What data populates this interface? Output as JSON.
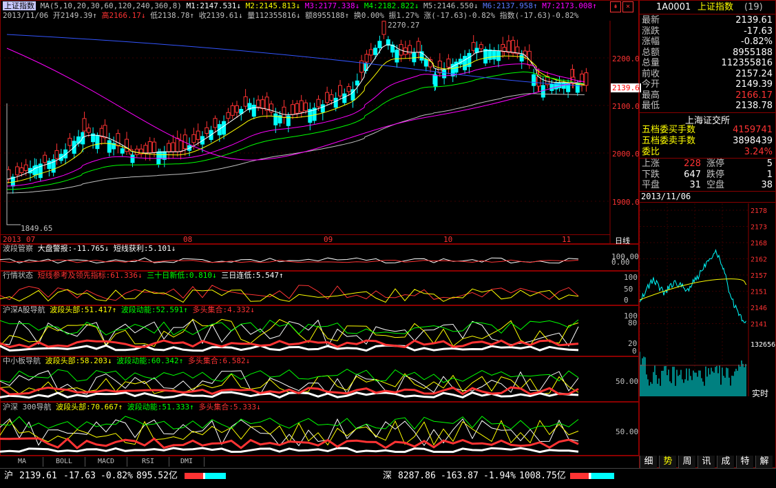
{
  "header": {
    "index_name": "上证指数",
    "ma_label": "MA(5,10,20,30,60,120,240,360,8)",
    "m1": "M1:2147.531↓",
    "m2": "M2:2145.813↓",
    "m3": "M3:2177.338↓",
    "m4": "M4:2182.822↓",
    "m5": "M5:2146.550↓",
    "m6": "M6:2137.958↑",
    "m7": "M7:2173.008↑",
    "date": "2013/11/06",
    "open": "开2149.39↑",
    "high": "高2166.17↓",
    "low": "低2138.78↑",
    "close": "收2139.61↓",
    "vol": "量112355816↓",
    "amount": "额8955188↑",
    "turnover": "换0.00%",
    "amplitude": "振1.27%",
    "change": "涨(-17.63)-0.82%",
    "index_change": "指数(-17.63)-0.82%"
  },
  "main_chart": {
    "peak_label": "2270.27",
    "low_label": "1849.65",
    "price_tag": "2139.6",
    "y_ticks": [
      "2200.0",
      "2100.0",
      "2000.0",
      "1900.0"
    ],
    "x_ticks": [
      "2013",
      "07",
      "08",
      "09",
      "10",
      "11"
    ],
    "period": "日线"
  },
  "indicators": [
    {
      "name": "波段管察",
      "items": [
        "大盘警报:-11.765↓",
        "短线获利:5.101↓"
      ],
      "axis": [
        "100.00",
        "0.00"
      ]
    },
    {
      "name": "行情状态",
      "items": [
        "短线参考及领先指标:61.336↓",
        "三十日新低:0.810↓",
        "三日连低:5.547↑"
      ],
      "axis": [
        "100",
        "50",
        "0"
      ]
    },
    {
      "name": "沪深A股导航",
      "items": [
        "波段头部:51.417↑",
        "波段动能:52.591↑",
        "多头集合:4.332↓"
      ],
      "axis": [
        "100",
        "80",
        "20",
        "0"
      ]
    },
    {
      "name": "中小板导航",
      "items": [
        "波段头部:58.203↓",
        "波段动能:60.342↑",
        "多头集合:6.582↓"
      ],
      "axis": [
        "50.00"
      ]
    },
    {
      "name": "沪深 300导航",
      "items": [
        "波段头部:70.667↑",
        "波段动能:51.333↑",
        "多头集合:5.333↓"
      ],
      "axis": [
        "50.00"
      ]
    }
  ],
  "bottom_tabs": [
    "MA",
    "BOLL",
    "MACD",
    "RSI",
    "DMI"
  ],
  "quote": {
    "code": "1A0001",
    "name": "上证指数",
    "count": "(19)",
    "rows": [
      {
        "label": "最新",
        "value": "2139.61",
        "color": "#ffffff"
      },
      {
        "label": "涨跌",
        "value": "-17.63",
        "color": "#ffffff"
      },
      {
        "label": "涨幅",
        "value": "-0.82%",
        "color": "#ffffff"
      },
      {
        "label": "总额",
        "value": "8955188",
        "color": "#ffffff"
      },
      {
        "label": "总量",
        "value": "112355816",
        "color": "#ffffff"
      },
      {
        "label": "前收",
        "value": "2157.24",
        "color": "#ffffff"
      },
      {
        "label": "今开",
        "value": "2149.39",
        "color": "#ffffff"
      },
      {
        "label": "最高",
        "value": "2166.17",
        "color": "#ff3333"
      },
      {
        "label": "最低",
        "value": "2138.78",
        "color": "#ffffff"
      }
    ],
    "exchange": "上海证交所",
    "buy_label": "五档委买手数",
    "buy_value": "4159741",
    "sell_label": "五档委卖手数",
    "sell_value": "3898439",
    "ratio_label": "委比",
    "ratio_value": "3.24%",
    "breadth": [
      {
        "l1": "上涨",
        "v1": "228",
        "l2": "涨停",
        "v2": "5"
      },
      {
        "l1": "下跌",
        "v1": "647",
        "l2": "跌停",
        "v2": "1"
      },
      {
        "l1": "平盘",
        "v1": "31",
        "l2": "空盘",
        "v2": "38"
      }
    ],
    "mini_date": "2013/11/06",
    "mini_ticks": [
      "2178",
      "2173",
      "2168",
      "2162",
      "2157",
      "2151",
      "2146",
      "2141"
    ],
    "vol_tick": "132656",
    "realtime": "实时",
    "right_tabs": [
      "细",
      "势",
      "周",
      "讯",
      "成",
      "特",
      "解"
    ]
  },
  "status": {
    "sh_label": "沪",
    "sh_value": "2139.61",
    "sh_change": "-17.63",
    "sh_pct": "-0.82%",
    "sh_amount": "895.52亿",
    "sz_label": "深",
    "sz_value": "8287.86",
    "sz_change": "-163.87",
    "sz_pct": "-1.94%",
    "sz_amount": "1008.75亿"
  }
}
